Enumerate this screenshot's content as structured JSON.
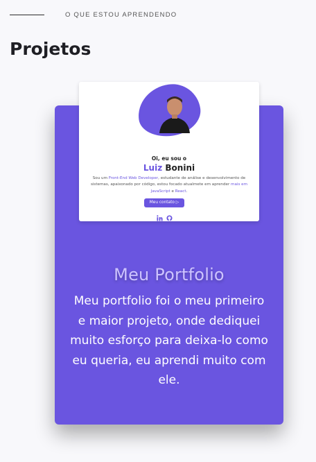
{
  "section": {
    "eyebrow": "O QUE ESTOU APRENDENDO",
    "title": "Projetos"
  },
  "project": {
    "title": "Meu Portfolio",
    "description": "Meu portfolio foi o meu primeiro e maior projeto, onde dediquei muito esforço para deixa-lo como eu queria, eu aprendi muito com ele.",
    "preview": {
      "greeting": "Oi, eu sou o",
      "first_name": "Luiz",
      "last_name": "Bonini",
      "desc_1": "Sou um ",
      "desc_hl_1": "Front-End Web Developer",
      "desc_2": ", estudante de análise e desenvolvimento de sistemas, apaixonado por código, estou focado atualmete em aprender ",
      "desc_hl_2": "mais em JavaScript",
      "desc_3": " e ",
      "desc_hl_3": "React",
      "desc_4": ".",
      "button": "Meu contato ▷",
      "icons": [
        "linkedin-icon",
        "github-icon"
      ]
    }
  },
  "colors": {
    "accent": "#6a55e0",
    "card_title": "#cdc3ff",
    "background": "#f8f8fb"
  }
}
